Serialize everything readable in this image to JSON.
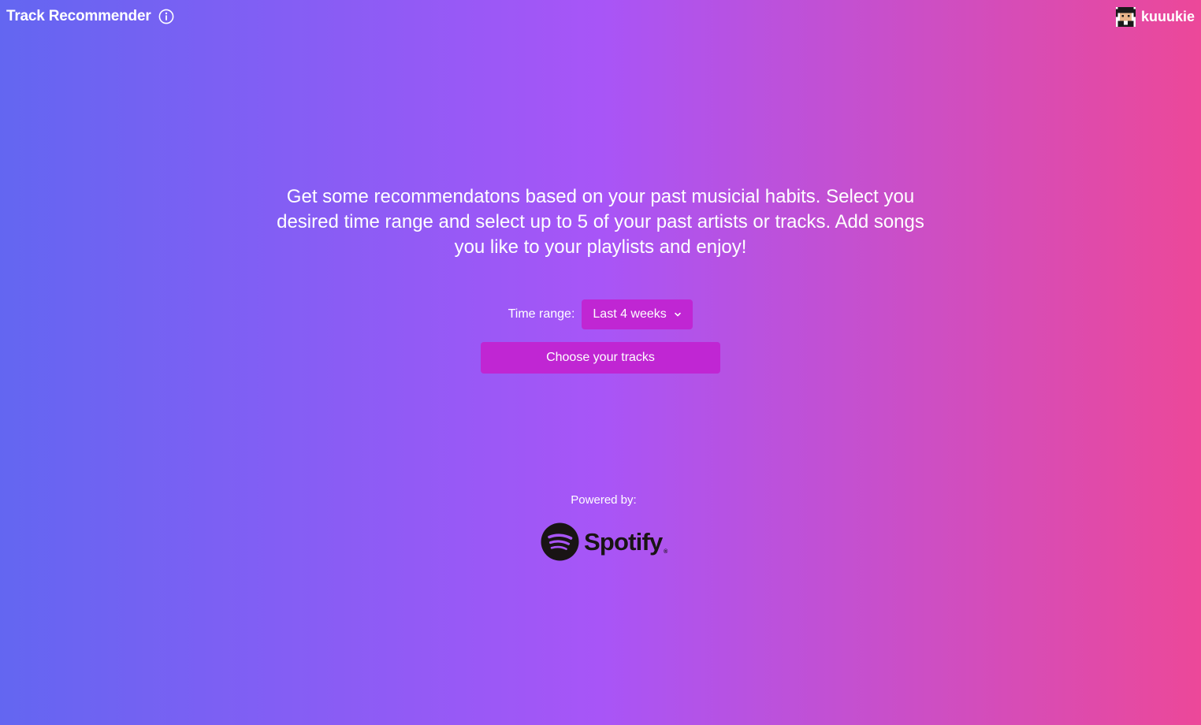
{
  "header": {
    "title": "Track Recommender",
    "info_icon": "info-circle-icon",
    "user": {
      "name": "kuuukie",
      "avatar_icon": "pixel-avatar-icon"
    }
  },
  "main": {
    "intro": "Get some recommendatons based on your past musicial habits. Select you desired time range and select up to 5 of your past artists or tracks. Add songs you like to your playlists and enjoy!",
    "time_range": {
      "label": "Time range:",
      "selected": "Last 4 weeks"
    },
    "choose_button": "Choose your tracks"
  },
  "footer": {
    "powered_by": "Powered by:",
    "logo_text": "Spotify",
    "logo_icon": "spotify-logo-icon"
  },
  "colors": {
    "gradient_start": "#6366f1",
    "gradient_mid": "#a855f7",
    "gradient_end": "#ec4899",
    "accent": "#c026d3",
    "spotify_black": "#191414"
  }
}
